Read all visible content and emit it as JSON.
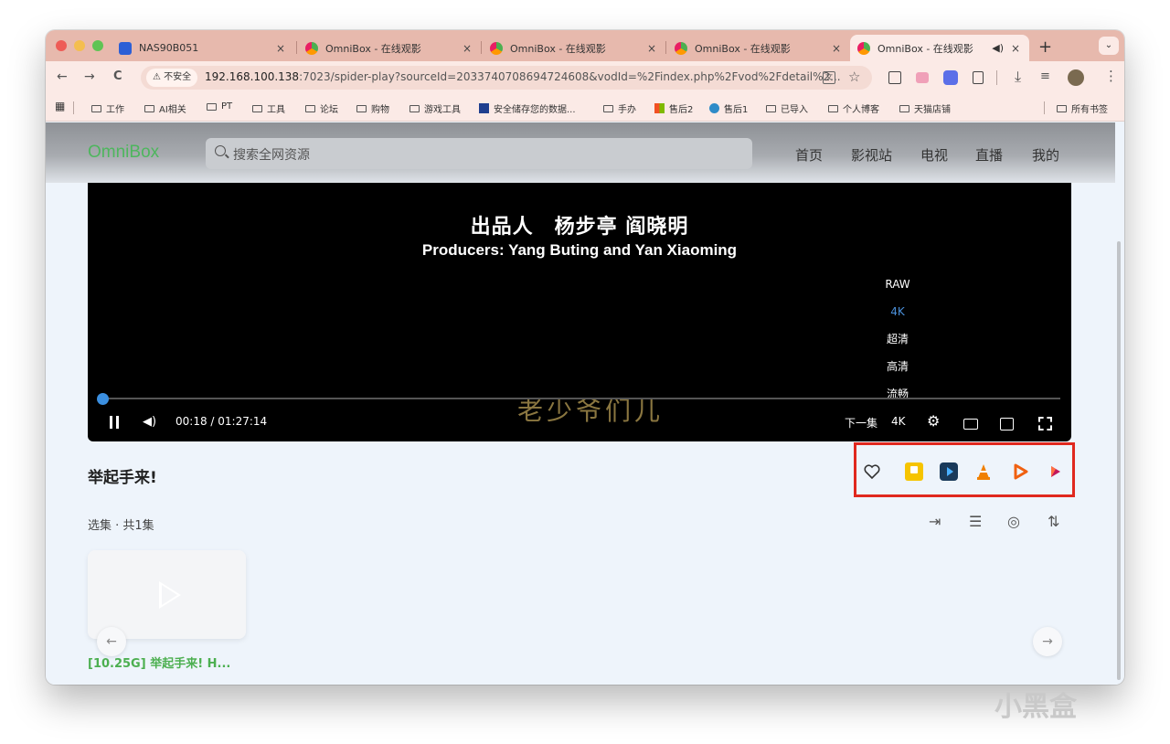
{
  "tabs": [
    {
      "title": "NAS90B051",
      "close": "×"
    },
    {
      "title": "OmniBox - 在线观影",
      "close": "×"
    },
    {
      "title": "OmniBox - 在线观影",
      "close": "×"
    },
    {
      "title": "OmniBox - 在线观影",
      "close": "×"
    },
    {
      "title": "OmniBox - 在线观影",
      "close": "×"
    }
  ],
  "new_tab": "+",
  "tab_menu": "⌄",
  "toolbar": {
    "back": "←",
    "forward": "→",
    "reload": "C",
    "insecure_label": "⚠ 不安全",
    "url_host": "192.168.100.138",
    "url_path": ":7023/spider-play?sourceId=2033740708694724608&vodId=%2Findex.php%2Fvod%2Fdetail%2...",
    "star": "☆",
    "download": "⤓",
    "menu": "⋮"
  },
  "bookmarks": {
    "apps": "▦",
    "items": [
      "工作",
      "AI相关",
      "PT",
      "工具",
      "论坛",
      "购物",
      "游戏工具",
      "安全储存您的数据...",
      "手办",
      "售后2",
      "售后1",
      "已导入",
      "个人博客",
      "天猫店铺"
    ],
    "all": "所有书签"
  },
  "site": {
    "logo": "OmniBox",
    "search_placeholder": "搜索全网资源",
    "nav": [
      "首页",
      "影视站",
      "电视",
      "直播",
      "我的"
    ]
  },
  "player": {
    "subtitle_cn": "出品人　杨步亭 阎晓明",
    "subtitle_en": "Producers: Yang Buting and Yan Xiaoming",
    "watermark": "老少爷们儿",
    "quality_options": [
      "RAW",
      "4K",
      "超清",
      "高清",
      "流畅"
    ],
    "quality_selected": "4K",
    "time": "00:18 / 01:27:14",
    "next_episode": "下一集",
    "quality_label": "4K",
    "progress_fraction": 0.0034
  },
  "video_title": "举起手来!",
  "episodes": {
    "header": "选集 · 共1集",
    "items": [
      {
        "label": "[10.25G] 举起手来! H..."
      }
    ],
    "prev": "←",
    "next": "→"
  },
  "external_player_icons": [
    "heart-icon",
    "potplayer-icon",
    "infuse-icon",
    "vlc-icon",
    "play-icon",
    "senplayer-icon"
  ],
  "colors": {
    "accent": "#3fb950",
    "highlight_box": "#e0281e",
    "progress": "#3b8fe0"
  },
  "watermark_brand": "小黑盒"
}
